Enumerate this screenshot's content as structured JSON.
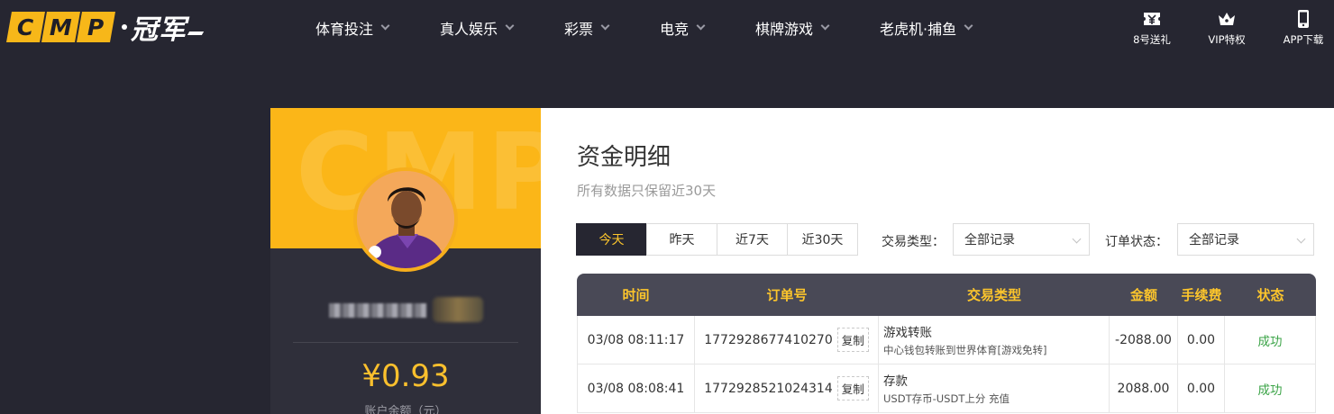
{
  "brand": {
    "letters": [
      "C",
      "M",
      "P"
    ],
    "name": "冠军"
  },
  "nav": [
    {
      "label": "体育投注"
    },
    {
      "label": "真人娱乐"
    },
    {
      "label": "彩票"
    },
    {
      "label": "电竞"
    },
    {
      "label": "棋牌游戏"
    },
    {
      "label": "老虎机·捕鱼"
    }
  ],
  "tools": [
    {
      "label": "8号送礼",
      "icon": "gift-ticket-icon"
    },
    {
      "label": "VIP特权",
      "icon": "crown-icon"
    },
    {
      "label": "APP下载",
      "icon": "phone-icon"
    }
  ],
  "profile": {
    "watermark": "CMP",
    "balance": "¥0.93",
    "balance_label": "账户余额（元）"
  },
  "page": {
    "title": "资金明细",
    "subtitle": "所有数据只保留近30天"
  },
  "filters": {
    "tabs": [
      {
        "label": "今天",
        "active": true
      },
      {
        "label": "昨天",
        "active": false
      },
      {
        "label": "近7天",
        "active": false
      },
      {
        "label": "近30天",
        "active": false
      }
    ],
    "type_label": "交易类型：",
    "type_value": "全部记录",
    "status_label": "订单状态：",
    "status_value": "全部记录"
  },
  "table": {
    "headers": [
      "时间",
      "订单号",
      "交易类型",
      "金额",
      "手续费",
      "状态"
    ],
    "copy_label": "复制",
    "rows": [
      {
        "time": "03/08 08:11:17",
        "order": "1772928677410270",
        "type": "游戏转账",
        "type_detail": "中心钱包转账到世界体育[游戏免转]",
        "amount": "-2088.00",
        "fee": "0.00",
        "status": "成功"
      },
      {
        "time": "03/08 08:08:41",
        "order": "1772928521024314",
        "type": "存款",
        "type_detail": "USDT存币-USDT上分 充值",
        "amount": "2088.00",
        "fee": "0.00",
        "status": "成功"
      }
    ]
  },
  "colors": {
    "accent": "#fcc52c",
    "nav_bg": "#262631",
    "header_bg": "#494956",
    "success": "#3aa346"
  }
}
